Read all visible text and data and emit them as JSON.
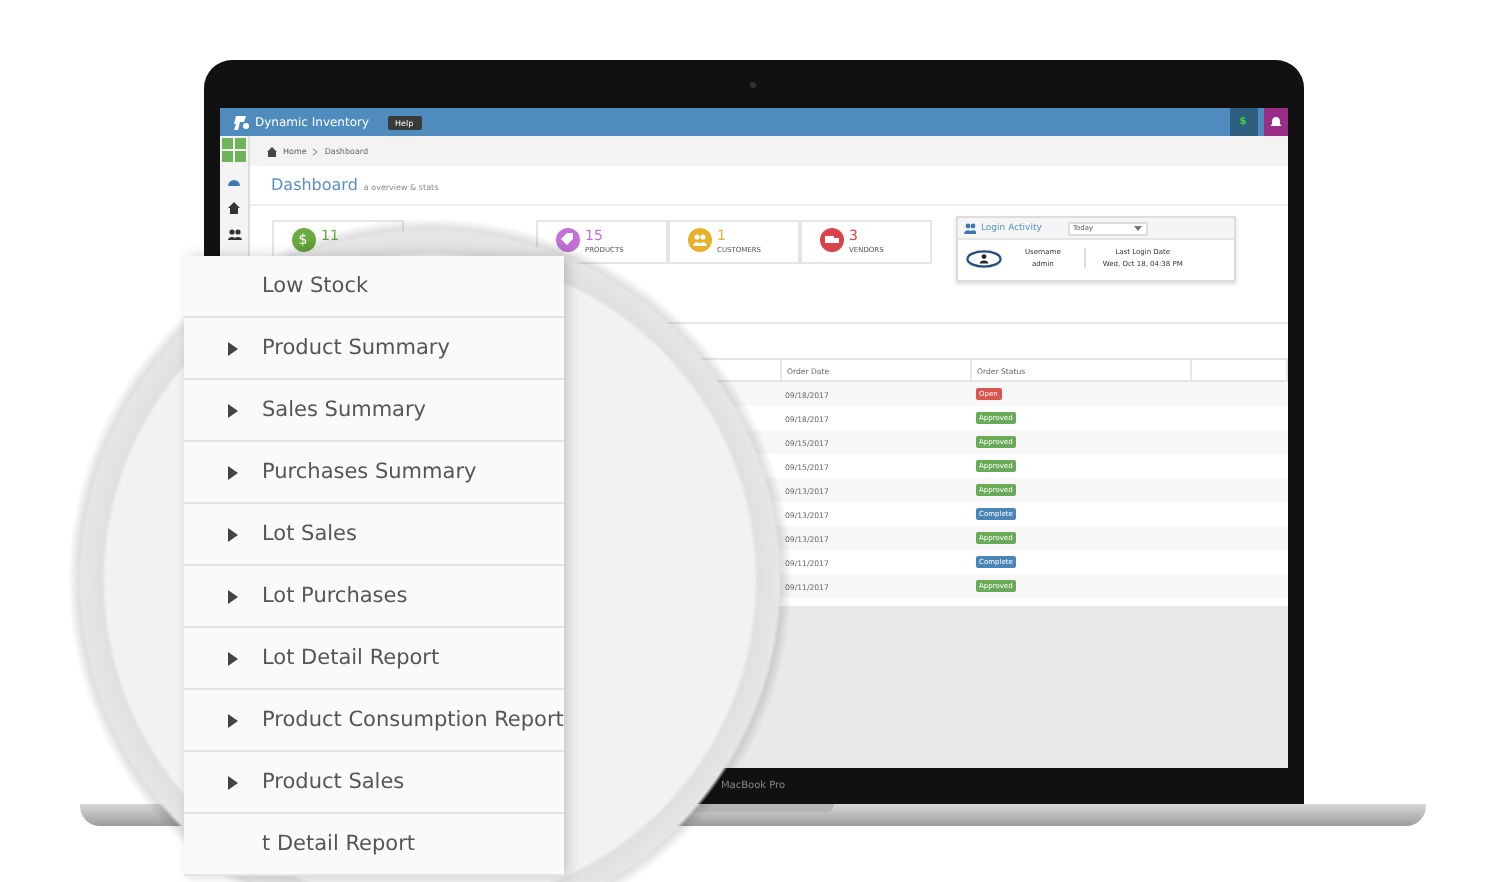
{
  "app": {
    "title": "Dynamic Inventory",
    "help": "Help",
    "currency_button": "$"
  },
  "breadcrumb": [
    {
      "label": "Home",
      "kind": "home"
    },
    {
      "label": "Dashboard",
      "kind": "page"
    }
  ],
  "page": {
    "title": "Dashboard",
    "subtitle": "a overview & stats"
  },
  "stats": [
    {
      "kind": "money",
      "symbol": "$",
      "value": "11",
      "color": "#6aab3f"
    },
    {
      "kind": "tag",
      "value": "15",
      "label": "PRODUCTS",
      "color": "#c46fd6"
    },
    {
      "kind": "users",
      "value": "1",
      "label": "CUSTOMERS",
      "color": "#e8b12a"
    },
    {
      "kind": "truck",
      "value": "3",
      "label": "VENDORS",
      "color": "#d9444a"
    }
  ],
  "login_activity": {
    "title": "Login Activity",
    "period": "Today",
    "columns": [
      {
        "heading": "Username",
        "value": "admin"
      },
      {
        "heading": "Last Login Date",
        "value": "Wed, Oct 18, 04:38 PM"
      }
    ]
  },
  "orders": {
    "columns": [
      "Order Date",
      "Order Status"
    ],
    "rows": [
      {
        "date": "09/18/2017",
        "status": "Open",
        "kind": "open"
      },
      {
        "date": "09/18/2017",
        "status": "Approved",
        "kind": "approved"
      },
      {
        "date": "09/15/2017",
        "status": "Approved",
        "kind": "approved"
      },
      {
        "date": "09/15/2017",
        "status": "Approved",
        "kind": "approved"
      },
      {
        "date": "09/13/2017",
        "status": "Approved",
        "kind": "approved"
      },
      {
        "date": "09/13/2017",
        "status": "Complete",
        "kind": "complete"
      },
      {
        "date": "09/13/2017",
        "status": "Approved",
        "kind": "approved"
      },
      {
        "date": "09/11/2017",
        "status": "Complete",
        "kind": "complete"
      },
      {
        "date": "09/11/2017",
        "status": "Approved",
        "kind": "approved"
      }
    ]
  },
  "report_menu": [
    {
      "label": "Low Stock",
      "arrow": false
    },
    {
      "label": "Product Summary",
      "arrow": true
    },
    {
      "label": "Sales Summary",
      "arrow": true
    },
    {
      "label": "Purchases Summary",
      "arrow": true
    },
    {
      "label": "Lot Sales",
      "arrow": true
    },
    {
      "label": "Lot Purchases",
      "arrow": true
    },
    {
      "label": "Lot Detail Report",
      "arrow": true
    },
    {
      "label": "Product Consumption Report",
      "arrow": true
    },
    {
      "label": "Product Sales",
      "arrow": true
    },
    {
      "label": "t Detail Report",
      "arrow": false
    }
  ],
  "device": {
    "label": "MacBook Pro"
  }
}
